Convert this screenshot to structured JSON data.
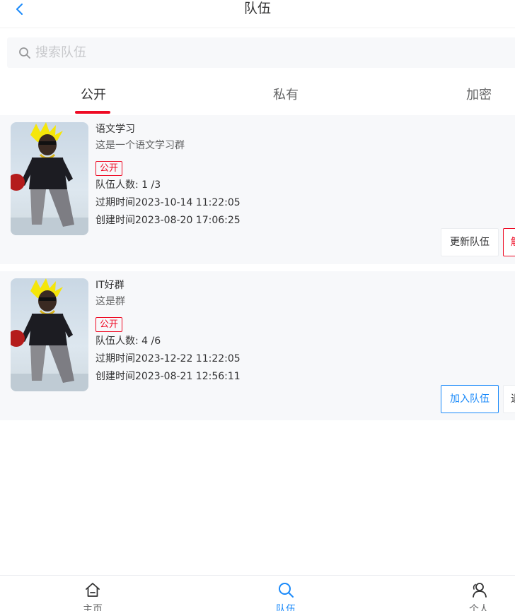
{
  "header": {
    "title": "队伍"
  },
  "search": {
    "placeholder": "搜索队伍",
    "value": ""
  },
  "tabs": [
    {
      "label": "公开",
      "active": true
    },
    {
      "label": "私有",
      "active": false
    },
    {
      "label": "加密",
      "active": false
    }
  ],
  "teams": [
    {
      "name": "语文学习",
      "description": "这是一个语文学习群",
      "tag": "公开",
      "members": "队伍人数: 1 /3",
      "expire": "过期时间2023-10-14 11:22:05",
      "created": "创建时间2023-08-20 17:06:25",
      "actions": [
        {
          "label": "更新队伍",
          "style": "default"
        },
        {
          "label": "解",
          "style": "danger-plain"
        }
      ]
    },
    {
      "name": "IT好群",
      "description": "这是群",
      "tag": "公开",
      "members": "队伍人数: 4 /6",
      "expire": "过期时间2023-12-22 11:22:05",
      "created": "创建时间2023-08-21 12:56:11",
      "actions": [
        {
          "label": "加入队伍",
          "style": "primary-plain"
        },
        {
          "label": "退",
          "style": "default"
        }
      ]
    }
  ],
  "tabbar": [
    {
      "label": "主页",
      "icon": "home-icon",
      "active": false
    },
    {
      "label": "队伍",
      "icon": "search-icon",
      "active": true
    },
    {
      "label": "个人",
      "icon": "user-icon",
      "active": false
    }
  ],
  "colors": {
    "primary": "#1989fa",
    "danger": "#ee0a24",
    "card_bg": "#f7f8fa"
  }
}
